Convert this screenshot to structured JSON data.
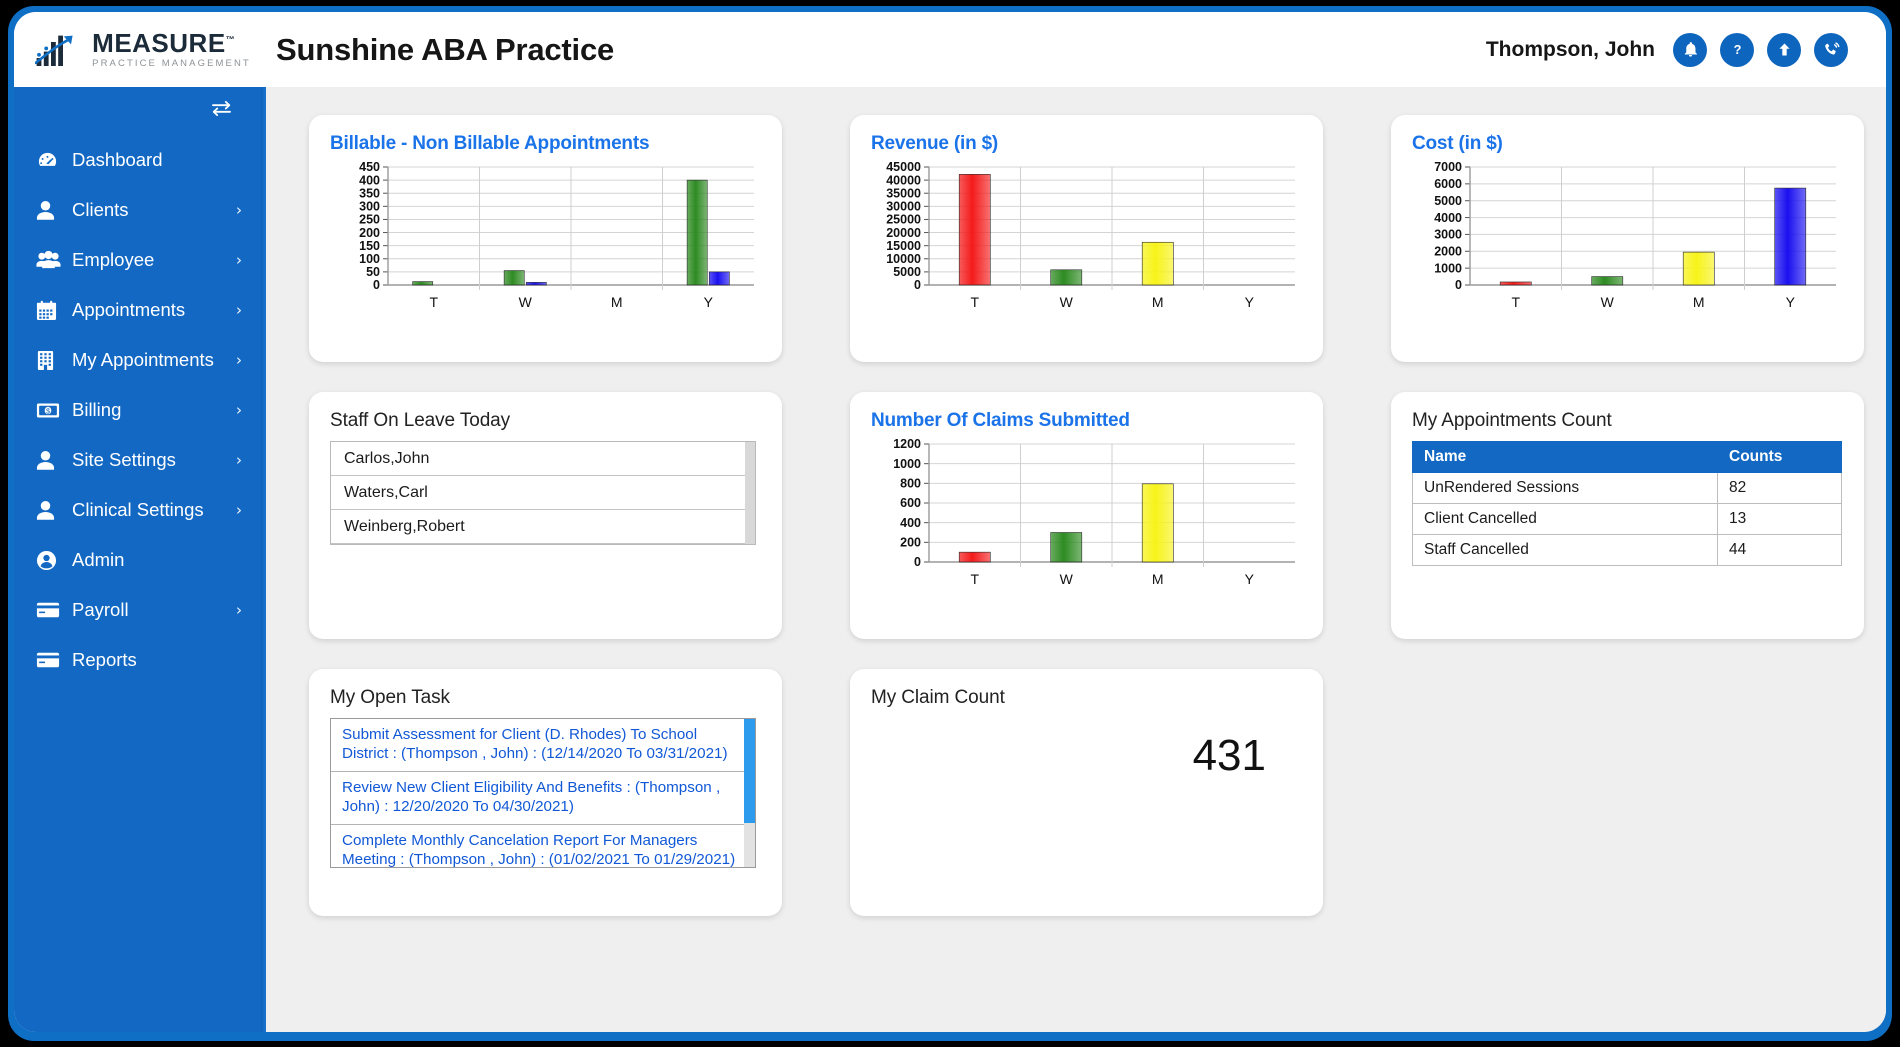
{
  "header": {
    "logo_main": "MEASURE",
    "logo_tm": "™",
    "logo_sub": "PRACTICE MANAGEMENT",
    "app_title": "Sunshine ABA Practice",
    "user_name": "Thompson, John",
    "icons": [
      {
        "name": "notification-bell-icon",
        "glyph": "bell"
      },
      {
        "name": "help-question-icon",
        "glyph": "question"
      },
      {
        "name": "upload-arrow-icon",
        "glyph": "arrow-up"
      },
      {
        "name": "call-support-icon",
        "glyph": "phone"
      }
    ]
  },
  "sidebar": {
    "toggle_icon": "collapse-sidebar-icon",
    "items": [
      {
        "label": "Dashboard",
        "icon": "dashboard-icon",
        "chevron": false
      },
      {
        "label": "Clients",
        "icon": "user-icon",
        "chevron": true
      },
      {
        "label": "Employee",
        "icon": "users-group-icon",
        "chevron": true
      },
      {
        "label": "Appointments",
        "icon": "calendar-icon",
        "chevron": true
      },
      {
        "label": "My Appointments",
        "icon": "building-icon",
        "chevron": true
      },
      {
        "label": "Billing",
        "icon": "money-bill-icon",
        "chevron": true
      },
      {
        "label": "Site Settings",
        "icon": "user-icon",
        "chevron": true
      },
      {
        "label": "Clinical Settings",
        "icon": "user-icon",
        "chevron": true
      },
      {
        "label": "Admin",
        "icon": "user-circle-icon",
        "chevron": false
      },
      {
        "label": "Payroll",
        "icon": "credit-card-icon",
        "chevron": true
      },
      {
        "label": "Reports",
        "icon": "credit-card-icon",
        "chevron": false
      }
    ]
  },
  "cards": {
    "billable": {
      "title": "Billable - Non Billable Appointments"
    },
    "revenue": {
      "title": "Revenue (in $)"
    },
    "cost": {
      "title": "Cost (in $)"
    },
    "staff_leave": {
      "title": "Staff On Leave Today",
      "rows": [
        "Carlos,John",
        "Waters,Carl",
        "Weinberg,Robert"
      ]
    },
    "claims": {
      "title": "Number Of Claims Submitted"
    },
    "appt_count": {
      "title": "My Appointments Count",
      "columns": [
        "Name",
        "Counts"
      ],
      "rows": [
        {
          "name": "UnRendered Sessions",
          "count": "82"
        },
        {
          "name": "Client Cancelled",
          "count": "13"
        },
        {
          "name": "Staff Cancelled",
          "count": "44"
        }
      ]
    },
    "open_task": {
      "title": "My Open Task",
      "items": [
        "Submit Assessment for Client (D. Rhodes) To School District : (Thompson , John) : (12/14/2020 To 03/31/2021)",
        "Review New Client Eligibility And Benefits : (Thompson , John) : 12/20/2020 To 04/30/2021)",
        "Complete Monthly Cancelation Report For Managers Meeting : (Thompson , John) : (01/02/2021 To 01/29/2021)"
      ]
    },
    "claim_count": {
      "title": "My Claim Count",
      "value": "431"
    }
  },
  "colors": {
    "brand_blue": "#1268c3",
    "link_blue": "#1a73e8",
    "bar_red": "#f41b1b",
    "bar_green": "#2e8b22",
    "bar_yellow": "#f7f319",
    "bar_blue": "#1a10f0"
  },
  "chart_data": [
    {
      "id": "billable",
      "type": "bar",
      "title": "Billable - Non Billable Appointments",
      "categories": [
        "T",
        "W",
        "M",
        "Y"
      ],
      "series": [
        {
          "name": "Billable",
          "color": "#2e8b22",
          "values": [
            13,
            55,
            0,
            400
          ]
        },
        {
          "name": "Non Billable",
          "color": "#1a10f0",
          "values": [
            0,
            10,
            0,
            50
          ]
        }
      ],
      "ylim": [
        0,
        450
      ],
      "yticks": [
        0,
        50,
        100,
        150,
        200,
        250,
        300,
        350,
        400,
        450
      ],
      "xlabel": "",
      "ylabel": "",
      "grid": true,
      "legend": "none"
    },
    {
      "id": "revenue",
      "type": "bar",
      "title": "Revenue (in $)",
      "categories": [
        "T",
        "W",
        "M",
        "Y"
      ],
      "values": [
        42200,
        5800,
        16300,
        0
      ],
      "colors": [
        "#f41b1b",
        "#2e8b22",
        "#f7f319",
        "#1a10f0"
      ],
      "ylim": [
        0,
        45000
      ],
      "yticks": [
        0,
        5000,
        10000,
        15000,
        20000,
        25000,
        30000,
        35000,
        40000,
        45000
      ],
      "xlabel": "",
      "ylabel": "",
      "grid": true,
      "legend": "none"
    },
    {
      "id": "cost",
      "type": "bar",
      "title": "Cost (in $)",
      "categories": [
        "T",
        "W",
        "M",
        "Y"
      ],
      "values": [
        180,
        500,
        1950,
        5750
      ],
      "colors": [
        "#f41b1b",
        "#2e8b22",
        "#f7f319",
        "#1a10f0"
      ],
      "ylim": [
        0,
        7000
      ],
      "yticks": [
        0,
        1000,
        2000,
        3000,
        4000,
        5000,
        6000,
        7000
      ],
      "xlabel": "",
      "ylabel": "",
      "grid": true,
      "legend": "none"
    },
    {
      "id": "claims",
      "type": "bar",
      "title": "Number Of Claims Submitted",
      "categories": [
        "T",
        "W",
        "M",
        "Y"
      ],
      "values": [
        100,
        300,
        795,
        0
      ],
      "colors": [
        "#f41b1b",
        "#2e8b22",
        "#f7f319",
        "#1a10f0"
      ],
      "ylim": [
        0,
        1200
      ],
      "yticks": [
        0,
        200,
        400,
        600,
        800,
        1000,
        1200
      ],
      "xlabel": "",
      "ylabel": "",
      "grid": true,
      "legend": "none"
    }
  ]
}
